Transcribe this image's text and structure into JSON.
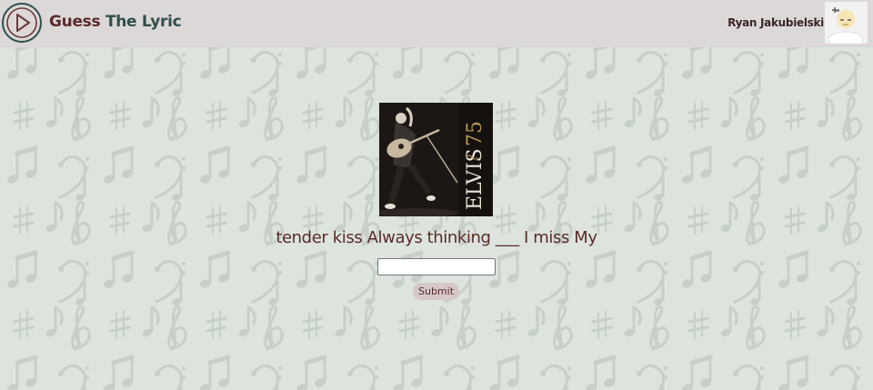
{
  "header": {
    "app_title_first": "Guess",
    "app_title_rest": " The Lyric",
    "user_name": "Ryan Jakubielski"
  },
  "album": {
    "text_main": "ELVIS",
    "text_number": "75"
  },
  "game": {
    "lyric": "tender kiss Always thinking ___ I miss My",
    "answer_value": "",
    "answer_placeholder": "",
    "submit_label": "Submit"
  },
  "colors": {
    "header_bg": "#dcd8d8",
    "page_bg": "#dce4dd",
    "lyric_text": "#5b2a2a",
    "logo_stroke": "#2f4f4d",
    "button_bg": "#d6c8c8"
  },
  "icons": {
    "logo": "play-circle-icon",
    "avatar": "user-avatar-icon",
    "background": "music-notes-pattern"
  }
}
